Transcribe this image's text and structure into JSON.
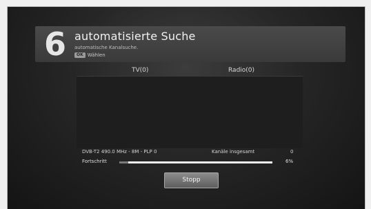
{
  "header": {
    "step_number": "6",
    "title": "automatisierte Suche",
    "subtitle": "automatische Kanalsuche.",
    "ok_key": "OK",
    "ok_label": "Wählen"
  },
  "columns": {
    "tv": "TV(0)",
    "radio": "Radio(0)"
  },
  "scan": {
    "frequency_info": "DVB-T2 490.0 MHz - 8M - PLP 0",
    "channels_total_label": "Kanäle insgesamt",
    "channels_total_value": "0",
    "progress_label": "Fortschritt",
    "progress_percent_text": "6%",
    "progress_fraction": 0.06
  },
  "buttons": {
    "stop_label": "Stopp"
  },
  "colors": {
    "background": "#262626",
    "header_panel": "#444444",
    "progress_track": "#f2f2f2",
    "progress_fill": "#7a7a7a"
  }
}
